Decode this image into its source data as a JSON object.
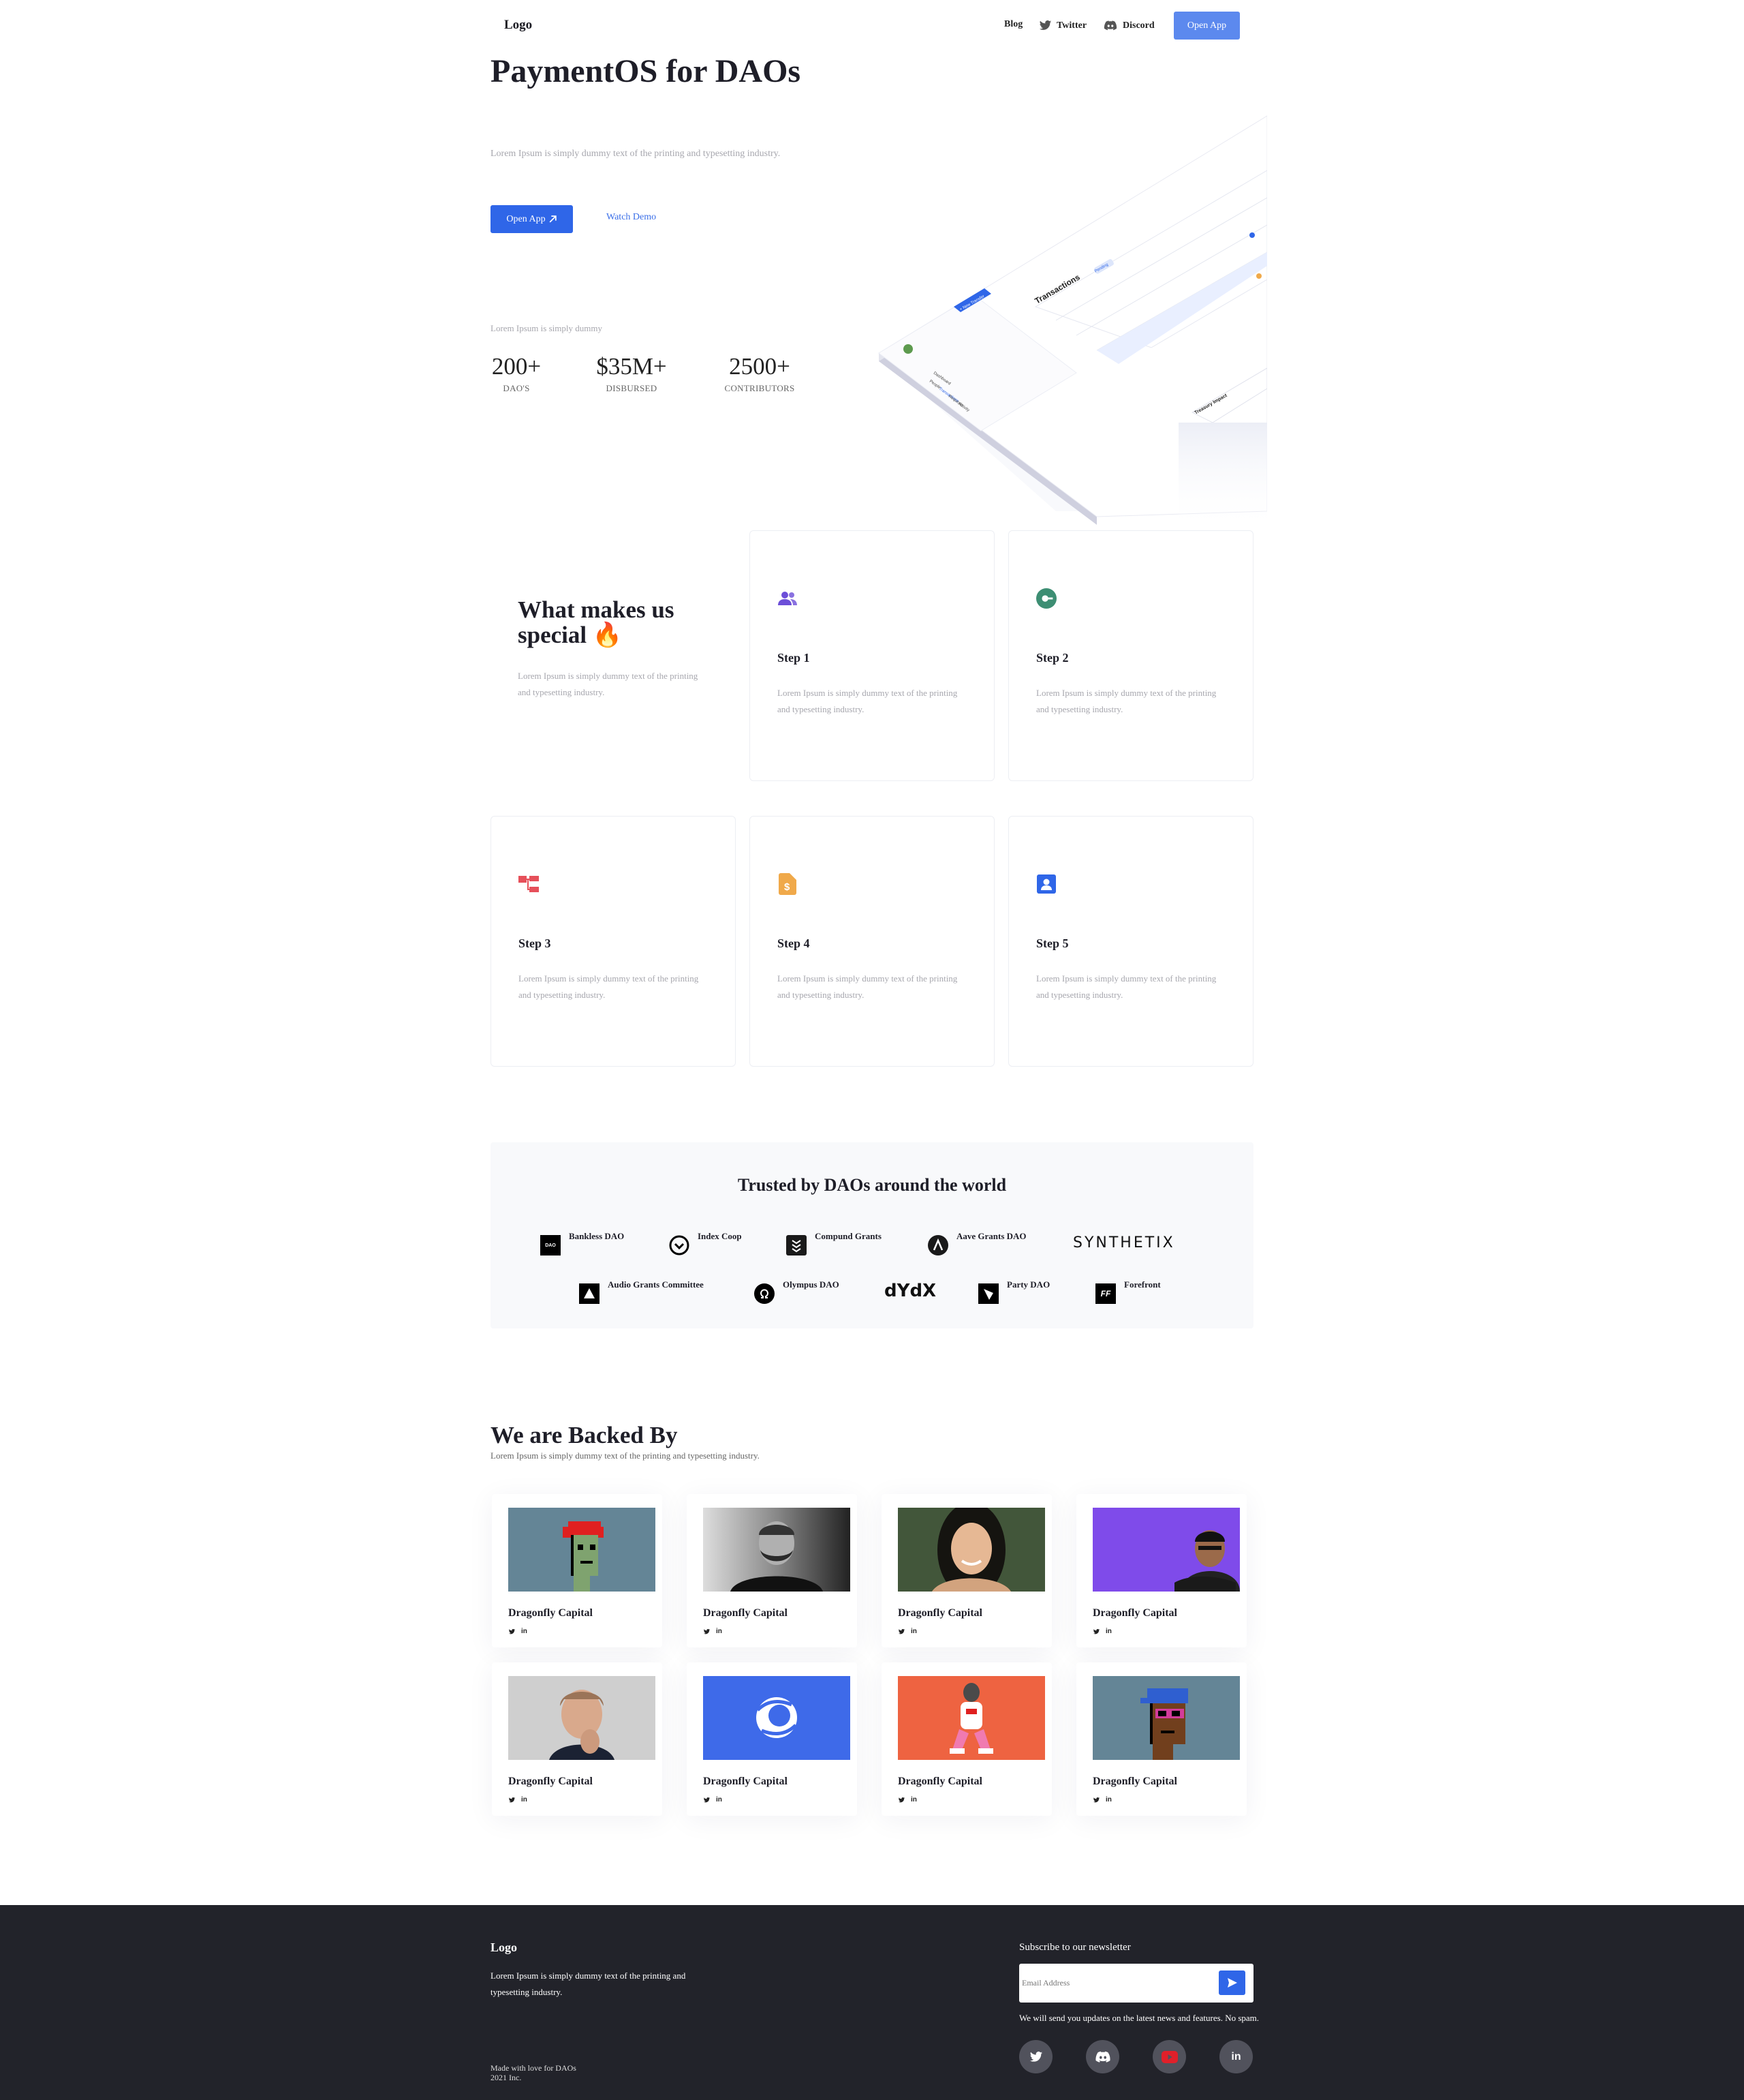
{
  "nav": {
    "logo": "Logo",
    "blog": "Blog",
    "twitter": "Twitter",
    "discord": "Discord",
    "open_app": "Open App"
  },
  "hero": {
    "title": "PaymentOS for DAOs",
    "subtitle": "Lorem Ipsum is simply dummy text of the printing and typesetting industry.",
    "open_app": "Open App",
    "watch_demo": "Watch Demo",
    "stats_caption": "Lorem Ipsum is simply dummy",
    "stats": [
      {
        "value": "200+",
        "label": "DAO'S"
      },
      {
        "value": "$35M+",
        "label": "DISBURSED"
      },
      {
        "value": "2500+",
        "label": "CONTRIBUTORS"
      }
    ]
  },
  "mockup": {
    "transactions": "Transactions",
    "pending": "Pending",
    "new_transfer": "+ New Transfer",
    "treasury": "Treasury Impact",
    "menu": [
      "Dashboard",
      "People",
      "Transactions",
      "Requests",
      "Activity"
    ]
  },
  "features": {
    "title": "What makes us special",
    "emoji": "🔥",
    "description": "Lorem Ipsum is simply dummy text of the printing and typesetting industry.",
    "steps": [
      {
        "title": "Step 1",
        "desc": "Lorem Ipsum is simply dummy text of the printing and typesetting industry.",
        "icon": "users-icon",
        "color": "#6c4ed8"
      },
      {
        "title": "Step 2",
        "desc": "Lorem Ipsum is simply dummy text of the printing and typesetting industry.",
        "icon": "toggle-icon",
        "color": "#3d8e73"
      },
      {
        "title": "Step 3",
        "desc": "Lorem Ipsum is simply dummy text of the printing and typesetting industry.",
        "icon": "hierarchy-icon",
        "color": "#e6505a"
      },
      {
        "title": "Step 4",
        "desc": "Lorem Ipsum is simply dummy text of the printing and typesetting industry.",
        "icon": "dollar-file-icon",
        "color": "#f0a94a"
      },
      {
        "title": "Step 5",
        "desc": "Lorem Ipsum is simply dummy text of the printing and typesetting industry.",
        "icon": "contact-card-icon",
        "color": "#2f66e8"
      }
    ]
  },
  "trusted": {
    "title": "Trusted by DAOs around the world",
    "daos": [
      "Bankless DAO",
      "Index Coop",
      "Compund Grants",
      "Aave Grants DAO",
      "SYNTHETIX",
      "Audio Grants Committee",
      "Olympus DAO",
      "dYdX",
      "Party DAO",
      "Forefront"
    ]
  },
  "backed": {
    "title": "We are Backed By",
    "subtitle": "Lorem Ipsum is simply dummy text of the printing and typesetting industry.",
    "investors": [
      {
        "name": "Dragonfly Capital",
        "photo": "pixel-punk-red-hair"
      },
      {
        "name": "Dragonfly Capital",
        "photo": "man-portrait-bw"
      },
      {
        "name": "Dragonfly Capital",
        "photo": "woman-portrait"
      },
      {
        "name": "Dragonfly Capital",
        "photo": "man-purple-bg"
      },
      {
        "name": "Dragonfly Capital",
        "photo": "man-portrait-hand"
      },
      {
        "name": "Dragonfly Capital",
        "photo": "blue-swirl-logo"
      },
      {
        "name": "Dragonfly Capital",
        "photo": "ape-orange-bg"
      },
      {
        "name": "Dragonfly Capital",
        "photo": "pixel-punk-cap"
      }
    ],
    "linkedin": "in"
  },
  "footer": {
    "logo": "Logo",
    "description": "Lorem Ipsum is simply dummy text of the printing and typesetting industry.",
    "made_with": "Made with love for DAOs",
    "copyright": "2021 Inc.",
    "newsletter_title": "Subscribe to our newsletter",
    "email_placeholder": "Email Address",
    "note": "We will send you updates on the latest news and features. No spam.",
    "socials": [
      "twitter-icon",
      "discord-icon",
      "youtube-icon",
      "linkedin-icon"
    ]
  }
}
